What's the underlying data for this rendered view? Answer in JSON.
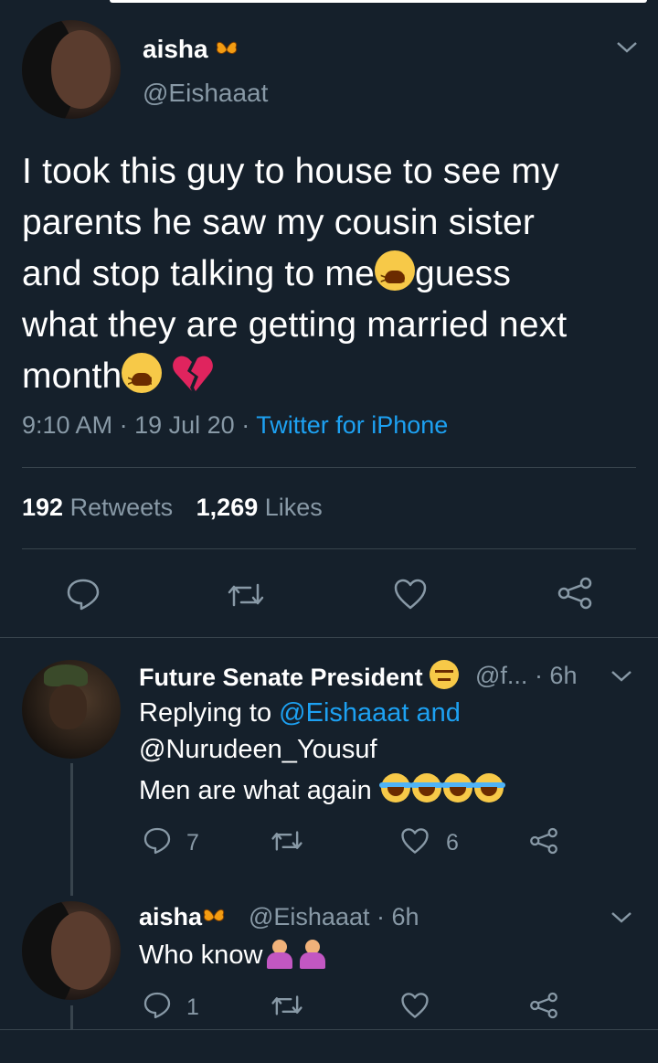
{
  "main_tweet": {
    "display_name": "aisha",
    "handle": "@Eishaaat",
    "text_lines": [
      "I took this guy to house to see my",
      "parents he saw my cousin sister",
      "and stop talking to me",
      "guess",
      "what they are getting married next",
      "month"
    ],
    "time": "9:10 AM",
    "date": "19 Jul 20",
    "source": "Twitter for iPhone",
    "retweets_count": "192",
    "retweets_label": "Retweets",
    "likes_count": "1,269",
    "likes_label": "Likes",
    "sep": "·"
  },
  "reply1": {
    "display_name": "Future Senate President",
    "handle": "@f...",
    "age": "· 6h",
    "replying_prefix": "Replying to",
    "replying_to_1": "@Eishaaat",
    "replying_and": "and",
    "replying_to_2": "@Nurudeen_Yousuf",
    "text": "Men are what again",
    "reply_count": "7",
    "like_count": "6"
  },
  "reply2": {
    "display_name": "aisha",
    "handle": "@Eishaaat",
    "age": "· 6h",
    "text": "Who know",
    "reply_count": "1"
  },
  "colors": {
    "background": "#15202b",
    "accent": "#1da1f2",
    "muted": "#8899a6",
    "divider": "#38444d"
  },
  "icons": [
    "chevron-down-icon",
    "reply-icon",
    "retweet-icon",
    "like-icon",
    "share-icon",
    "butterfly-icon"
  ]
}
